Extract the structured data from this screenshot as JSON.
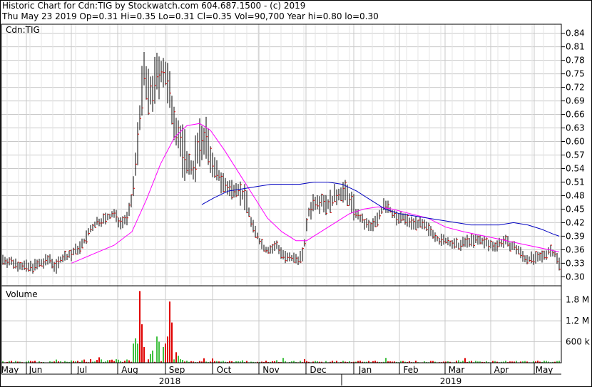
{
  "header": {
    "line1": "Historic Chart for Cdn:TIG by Stockwatch.com 604.687.1500 - (c) 2019",
    "line2": "Thu May 23 2019  Op=0.31  Hi=0.35  Lo=0.31  Cl=0.35  Vol=90,700  Year hi=0.80  lo=0.30"
  },
  "price_panel": {
    "label": "Cdn:TIG"
  },
  "volume_panel": {
    "label": "Volume"
  },
  "colors": {
    "ma_short": "#ff00ff",
    "ma_long": "#0000c0",
    "up_volume": "#40c040",
    "down_volume": "#e00000",
    "grid": "#c8c8c8",
    "close_tick": "#e00000"
  },
  "chart_data": [
    {
      "type": "line",
      "name": "price",
      "yticks": [
        "0.84",
        "0.81",
        "0.78",
        "0.75",
        "0.72",
        "0.69",
        "0.66",
        "0.63",
        "0.60",
        "0.57",
        "0.54",
        "0.51",
        "0.48",
        "0.45",
        "0.42",
        "0.39",
        "0.36",
        "0.33",
        "0.30"
      ],
      "ylim": [
        0.28,
        0.86
      ],
      "months": [
        "May",
        "Jun",
        "Jul",
        "Aug",
        "Sep",
        "Oct",
        "Nov",
        "Dec",
        "Jan",
        "Feb",
        "Mar",
        "Apr",
        "May"
      ],
      "years": [
        "2018",
        "2019"
      ],
      "price_path": [
        [
          0,
          0.34
        ],
        [
          20,
          0.33
        ],
        [
          40,
          0.32
        ],
        [
          60,
          0.33
        ],
        [
          70,
          0.34
        ],
        [
          78,
          0.32
        ],
        [
          85,
          0.34
        ],
        [
          100,
          0.35
        ],
        [
          115,
          0.37
        ],
        [
          125,
          0.4
        ],
        [
          135,
          0.42
        ],
        [
          150,
          0.43
        ],
        [
          160,
          0.44
        ],
        [
          168,
          0.42
        ],
        [
          178,
          0.43
        ],
        [
          185,
          0.47
        ],
        [
          190,
          0.55
        ],
        [
          196,
          0.66
        ],
        [
          202,
          0.75
        ],
        [
          208,
          0.7
        ],
        [
          215,
          0.72
        ],
        [
          222,
          0.75
        ],
        [
          228,
          0.76
        ],
        [
          233,
          0.74
        ],
        [
          240,
          0.68
        ],
        [
          246,
          0.64
        ],
        [
          252,
          0.6
        ],
        [
          258,
          0.57
        ],
        [
          264,
          0.55
        ],
        [
          270,
          0.54
        ],
        [
          276,
          0.57
        ],
        [
          282,
          0.6
        ],
        [
          288,
          0.61
        ],
        [
          294,
          0.57
        ],
        [
          300,
          0.54
        ],
        [
          308,
          0.52
        ],
        [
          316,
          0.5
        ],
        [
          324,
          0.49
        ],
        [
          332,
          0.5
        ],
        [
          340,
          0.48
        ],
        [
          346,
          0.47
        ],
        [
          352,
          0.42
        ],
        [
          358,
          0.4
        ],
        [
          364,
          0.38
        ],
        [
          372,
          0.36
        ],
        [
          380,
          0.36
        ],
        [
          388,
          0.37
        ],
        [
          396,
          0.35
        ],
        [
          402,
          0.34
        ],
        [
          410,
          0.34
        ],
        [
          418,
          0.34
        ],
        [
          425,
          0.35
        ],
        [
          432,
          0.44
        ],
        [
          438,
          0.46
        ],
        [
          444,
          0.47
        ],
        [
          452,
          0.47
        ],
        [
          460,
          0.46
        ],
        [
          466,
          0.47
        ],
        [
          472,
          0.48
        ],
        [
          480,
          0.49
        ],
        [
          488,
          0.48
        ],
        [
          494,
          0.46
        ],
        [
          500,
          0.44
        ],
        [
          510,
          0.42
        ],
        [
          520,
          0.41
        ],
        [
          530,
          0.43
        ],
        [
          538,
          0.46
        ],
        [
          546,
          0.45
        ],
        [
          556,
          0.43
        ],
        [
          566,
          0.43
        ],
        [
          576,
          0.42
        ],
        [
          586,
          0.42
        ],
        [
          596,
          0.41
        ],
        [
          606,
          0.4
        ],
        [
          616,
          0.38
        ],
        [
          626,
          0.38
        ],
        [
          636,
          0.37
        ],
        [
          646,
          0.37
        ],
        [
          656,
          0.38
        ],
        [
          666,
          0.38
        ],
        [
          676,
          0.38
        ],
        [
          686,
          0.37
        ],
        [
          696,
          0.37
        ],
        [
          706,
          0.38
        ],
        [
          716,
          0.37
        ],
        [
          726,
          0.36
        ],
        [
          736,
          0.34
        ],
        [
          746,
          0.34
        ],
        [
          756,
          0.34
        ],
        [
          764,
          0.35
        ],
        [
          772,
          0.36
        ],
        [
          778,
          0.35
        ],
        [
          784,
          0.33
        ]
      ],
      "ma_short": [
        [
          100,
          0.33
        ],
        [
          130,
          0.35
        ],
        [
          160,
          0.37
        ],
        [
          185,
          0.4
        ],
        [
          205,
          0.47
        ],
        [
          225,
          0.55
        ],
        [
          245,
          0.61
        ],
        [
          262,
          0.635
        ],
        [
          280,
          0.64
        ],
        [
          295,
          0.625
        ],
        [
          315,
          0.58
        ],
        [
          335,
          0.53
        ],
        [
          355,
          0.48
        ],
        [
          375,
          0.43
        ],
        [
          395,
          0.4
        ],
        [
          415,
          0.38
        ],
        [
          430,
          0.38
        ],
        [
          450,
          0.4
        ],
        [
          470,
          0.42
        ],
        [
          490,
          0.44
        ],
        [
          510,
          0.45
        ],
        [
          530,
          0.455
        ],
        [
          550,
          0.45
        ],
        [
          575,
          0.44
        ],
        [
          600,
          0.43
        ],
        [
          625,
          0.41
        ],
        [
          650,
          0.4
        ],
        [
          680,
          0.39
        ],
        [
          710,
          0.38
        ],
        [
          740,
          0.37
        ],
        [
          770,
          0.36
        ],
        [
          784,
          0.355
        ]
      ],
      "ma_long": [
        [
          283,
          0.46
        ],
        [
          300,
          0.475
        ],
        [
          320,
          0.49
        ],
        [
          340,
          0.495
        ],
        [
          360,
          0.5
        ],
        [
          380,
          0.505
        ],
        [
          400,
          0.505
        ],
        [
          420,
          0.505
        ],
        [
          440,
          0.51
        ],
        [
          460,
          0.51
        ],
        [
          480,
          0.505
        ],
        [
          500,
          0.49
        ],
        [
          520,
          0.47
        ],
        [
          540,
          0.45
        ],
        [
          560,
          0.44
        ],
        [
          580,
          0.435
        ],
        [
          600,
          0.43
        ],
        [
          620,
          0.425
        ],
        [
          640,
          0.42
        ],
        [
          660,
          0.415
        ],
        [
          680,
          0.415
        ],
        [
          700,
          0.415
        ],
        [
          720,
          0.42
        ],
        [
          740,
          0.415
        ],
        [
          760,
          0.405
        ],
        [
          775,
          0.395
        ],
        [
          784,
          0.39
        ]
      ]
    },
    {
      "type": "bar",
      "name": "volume",
      "yticks": [
        "1.8 M",
        "1.2 M",
        "600 k"
      ],
      "ylim": [
        0,
        2.2
      ],
      "heavy_bars": [
        [
          186,
          0.55,
          "up"
        ],
        [
          190,
          0.7,
          "up"
        ],
        [
          193,
          0.55,
          "up"
        ],
        [
          197,
          2.05,
          "down"
        ],
        [
          200,
          1.1,
          "down"
        ],
        [
          203,
          0.45,
          "down"
        ],
        [
          210,
          0.25,
          "up"
        ],
        [
          214,
          0.35,
          "up"
        ],
        [
          220,
          0.75,
          "up"
        ],
        [
          224,
          0.6,
          "up"
        ],
        [
          228,
          0.45,
          "up"
        ],
        [
          232,
          0.55,
          "down"
        ],
        [
          235,
          0.75,
          "down"
        ],
        [
          239,
          1.75,
          "down"
        ],
        [
          242,
          1.15,
          "down"
        ],
        [
          246,
          0.3,
          "down"
        ],
        [
          250,
          0.2,
          "up"
        ]
      ]
    }
  ]
}
